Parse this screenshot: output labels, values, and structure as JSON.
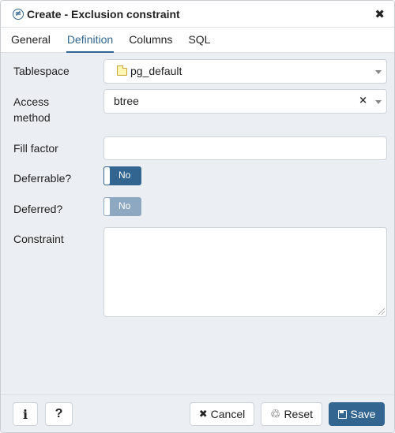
{
  "dialog": {
    "title": "Create - Exclusion constraint",
    "close_glyph": "✖",
    "title_icon": "≠"
  },
  "tabs": [
    {
      "label": "General"
    },
    {
      "label": "Definition",
      "active": true
    },
    {
      "label": "Columns"
    },
    {
      "label": "SQL"
    }
  ],
  "form": {
    "tablespace": {
      "label": "Tablespace",
      "value": "pg_default",
      "icon": "folder-icon"
    },
    "access_method": {
      "label_line1": "Access",
      "label_line2": "method",
      "value": "btree",
      "clear_glyph": "×"
    },
    "fill_factor": {
      "label": "Fill factor",
      "value": ""
    },
    "deferrable": {
      "label": "Deferrable?",
      "value": "No"
    },
    "deferred": {
      "label": "Deferred?",
      "value": "No",
      "disabled": true
    },
    "constraint": {
      "label": "Constraint",
      "value": ""
    }
  },
  "footer": {
    "info_glyph": "i",
    "help_glyph": "?",
    "cancel_label": "Cancel",
    "cancel_glyph": "✖",
    "reset_label": "Reset",
    "reset_glyph": "♲",
    "save_label": "Save"
  },
  "colors": {
    "accent": "#326690",
    "background": "#ebeef3",
    "disabled_toggle": "#8fa8c1"
  }
}
